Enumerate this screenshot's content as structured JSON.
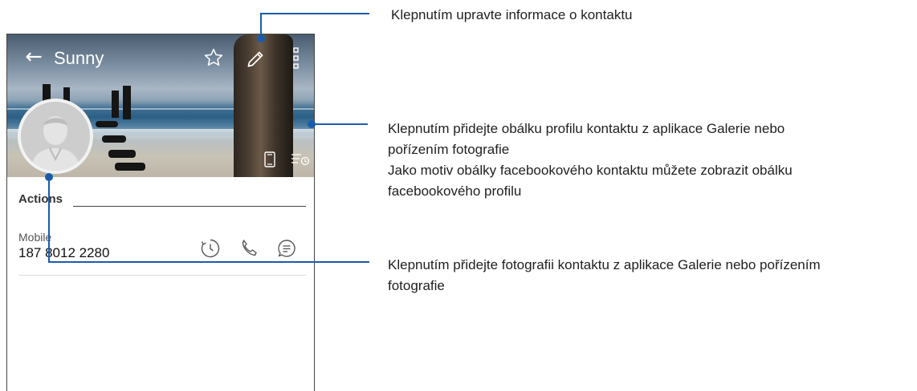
{
  "contact": {
    "name": "Sunny",
    "section_title": "Actions",
    "phone_label": "Mobile",
    "phone_number": "187 8012 2280"
  },
  "toolbar": {
    "back_icon": "arrow-left-icon",
    "favorite_icon": "star-outline-icon",
    "edit_icon": "pencil-icon",
    "more_icon": "more-vertical-icon"
  },
  "row_actions": [
    "call-history-icon",
    "phone-call-icon",
    "message-icon"
  ],
  "callouts": {
    "edit": "Klepnutím upravte informace o kontaktu",
    "cover_line1": "Klepnutím přidejte obálku profilu kontaktu z aplikace Galerie nebo",
    "cover_line2": "pořízením fotografie",
    "cover_line3": "Jako motiv obálky facebookového kontaktu můžete zobrazit obálku",
    "cover_line4": "facebookového profilu",
    "photo_line1": "Klepnutím přidejte fotografii kontaktu z aplikace Galerie nebo pořízením",
    "photo_line2": "fotografie"
  },
  "colors": {
    "callout": "#1a5cab"
  }
}
